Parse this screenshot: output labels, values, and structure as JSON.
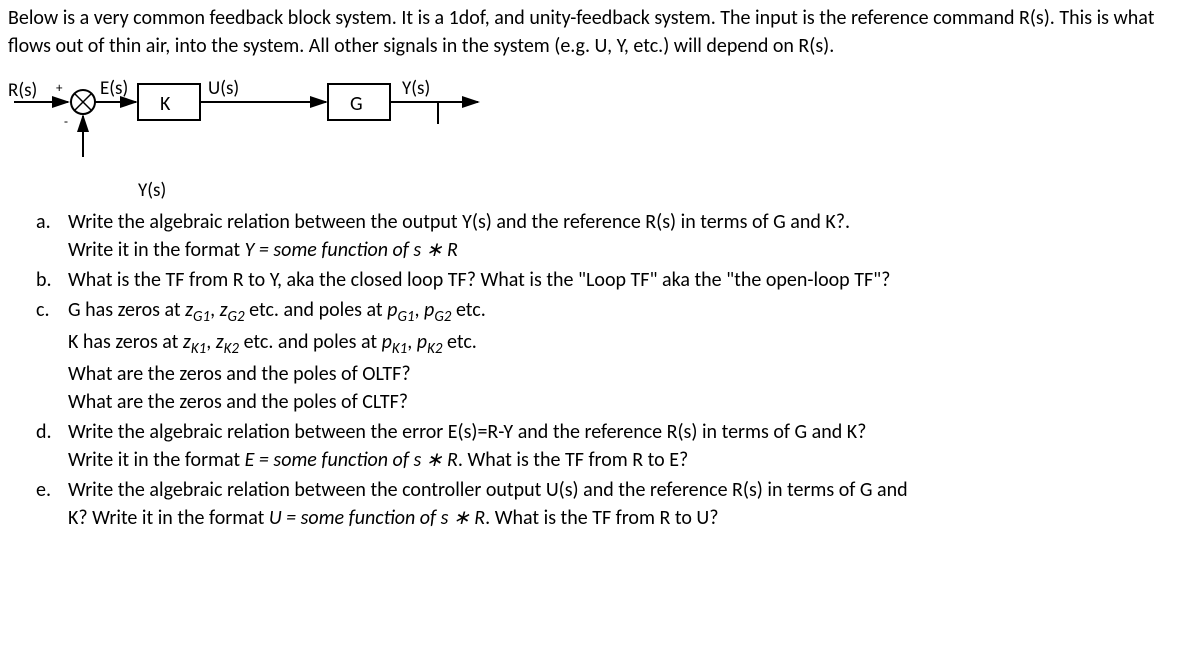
{
  "intro": "Below is a very common feedback block system. It is a 1dof, and unity-feedback system. The input is the reference command R(s). This is what flows out of thin air, into the system. All other signals in the system (e.g. U, Y, etc.) will depend on R(s).",
  "diagram": {
    "R": "R(s)",
    "E": "E(s)",
    "K": "K",
    "U": "U(s)",
    "G": "G",
    "Y": "Y(s)",
    "Yfb": "Y(s)",
    "plus": "+",
    "minus": "-"
  },
  "q": {
    "a": {
      "marker": "a.",
      "l1": "Write the algebraic relation between the output Y(s) and the reference R(s) in terms of G and K?.",
      "l2a": "Write it in the format ",
      "l2b": "Y = some function of s ∗ R"
    },
    "b": {
      "marker": "b.",
      "l1": "What is the TF from R to Y, aka the closed loop TF? What is the \"Loop TF\" aka the \"the open-loop TF\"?"
    },
    "c": {
      "marker": "c.",
      "l1a": "G has zeros at ",
      "zg1": "z",
      "zg1s": "G1",
      "sep": ", ",
      "zg2": "z",
      "zg2s": "G2",
      "l1b": " etc. and poles at ",
      "pg1": "p",
      "pg1s": "G1",
      "pg2": "p",
      "pg2s": "G2",
      "l1c": " etc.",
      "l2a": "K has zeros at ",
      "zk1": "z",
      "zk1s": "K1",
      "zk2": "z",
      "zk2s": "K2",
      "l2b": " etc. and poles at ",
      "pk1": "p",
      "pk1s": "K1",
      "pk2": "p",
      "pk2s": "K2",
      "l2c": " etc.",
      "l3": "What are the zeros and the poles of OLTF?",
      "l4": "What are the zeros and the poles of CLTF?"
    },
    "d": {
      "marker": "d.",
      "l1": "Write the algebraic relation between the error E(s)=R-Y and the reference R(s) in terms of G and K?",
      "l2a": "Write it in the format ",
      "l2b": "E = some function of s ∗ R",
      "l2c": ". What is the TF from R to E?"
    },
    "e": {
      "marker": "e.",
      "l1": "Write the algebraic relation between the controller output U(s) and the reference R(s) in terms of G and",
      "l2a": "K?  Write it in the format ",
      "l2b": "U = some function of s ∗ R",
      "l2c": ". What is the TF from R to U?"
    }
  }
}
